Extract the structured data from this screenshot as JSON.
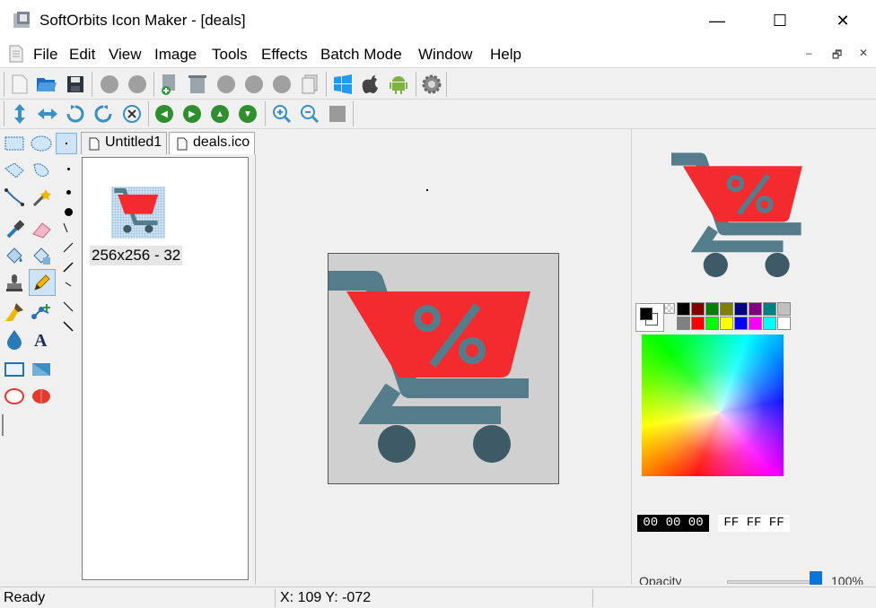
{
  "window": {
    "title": "SoftOrbits Icon Maker - [deals]",
    "minimize_glyph": "—",
    "maximize_glyph": "☐",
    "close_glyph": "✕"
  },
  "menu": {
    "items": [
      "File",
      "Edit",
      "View",
      "Image",
      "Tools",
      "Effects",
      "Batch Mode",
      "Window",
      "Help"
    ],
    "mdi_minimize": "–",
    "mdi_restore": "🗗",
    "mdi_close": "✕"
  },
  "toolbar1": {
    "icons": [
      "new-file-icon",
      "open-folder-icon",
      "save-icon",
      "disabled-icon",
      "disabled-icon",
      "add-image-icon",
      "image-strip-icon",
      "disabled-icon",
      "disabled-icon",
      "disabled-icon",
      "pages-icon",
      "windows-icon",
      "apple-icon",
      "android-icon",
      "settings-gear-icon"
    ]
  },
  "toolbar2": {
    "icons": [
      "resize-vertical-icon",
      "resize-horizontal-icon",
      "rotate-left-icon",
      "rotate-right-icon",
      "clear-icon",
      "nav-left-icon",
      "nav-right-icon",
      "nav-up-icon",
      "nav-down-icon",
      "zoom-in-icon",
      "zoom-out-icon",
      "fit-icon"
    ]
  },
  "tabs": [
    {
      "label": "Untitled1"
    },
    {
      "label": "deals.ico"
    }
  ],
  "thumbnails": [
    {
      "label": "256x256 - 32"
    }
  ],
  "colors": {
    "cart_red": "#f32b2f",
    "cart_gray": "#557c8b",
    "wheel_dark": "#3d5a66",
    "canvas_bg": "#d0d0d0"
  },
  "palette": [
    "#000000",
    "#800000",
    "#008000",
    "#808000",
    "#000080",
    "#800080",
    "#008080",
    "#c0c0c0",
    "#808080",
    "#ff0000",
    "#00ff00",
    "#ffff00",
    "#0000ff",
    "#ff00ff",
    "#00ffff",
    "#ffffff"
  ],
  "color_panel": {
    "foreground_hex": "00 00 00",
    "background_hex": "FF FF FF",
    "opacity_label": "Opacity",
    "opacity_value": "100%"
  },
  "status": {
    "state": "Ready",
    "coords": "X: 109 Y: -072"
  }
}
